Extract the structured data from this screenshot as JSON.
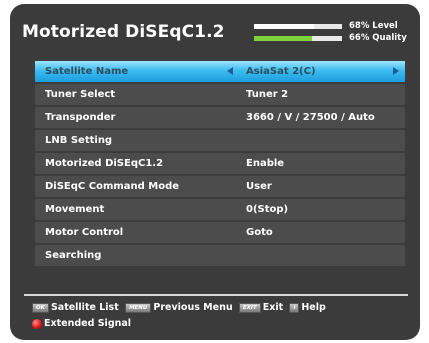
{
  "header": {
    "title": "Motorized DiSEqC1.2",
    "level": {
      "value": 68,
      "text": "68% Level"
    },
    "quality": {
      "value": 66,
      "text": "66% Quality"
    }
  },
  "menu": {
    "items": [
      {
        "label": "Satellite Name",
        "value": "AsiaSat 2(C)",
        "selected": true
      },
      {
        "label": "Tuner Select",
        "value": "Tuner 2"
      },
      {
        "label": "Transponder",
        "value": "3660 / V / 27500 / Auto"
      },
      {
        "label": "LNB Setting",
        "value": ""
      },
      {
        "label": "Motorized DiSEqC1.2",
        "value": "Enable"
      },
      {
        "label": "DiSEqC Command Mode",
        "value": "User"
      },
      {
        "label": "Movement",
        "value": "0(Stop)"
      },
      {
        "label": "Motor Control",
        "value": "Goto"
      },
      {
        "label": "Searching",
        "value": ""
      }
    ]
  },
  "footer": {
    "ok_key": "OK",
    "ok_label": "Satellite List",
    "menu_key": "MENU",
    "menu_label": "Previous Menu",
    "exit_key": "EXIT",
    "exit_label": "Exit",
    "help_key": "i",
    "help_label": "Help",
    "red_label": "Extended Signal"
  },
  "colors": {
    "background": "#3b3b3b",
    "selected_row": "#3cbcf0",
    "quality_bar": "#7fd23c",
    "red_button": "#e01010"
  }
}
